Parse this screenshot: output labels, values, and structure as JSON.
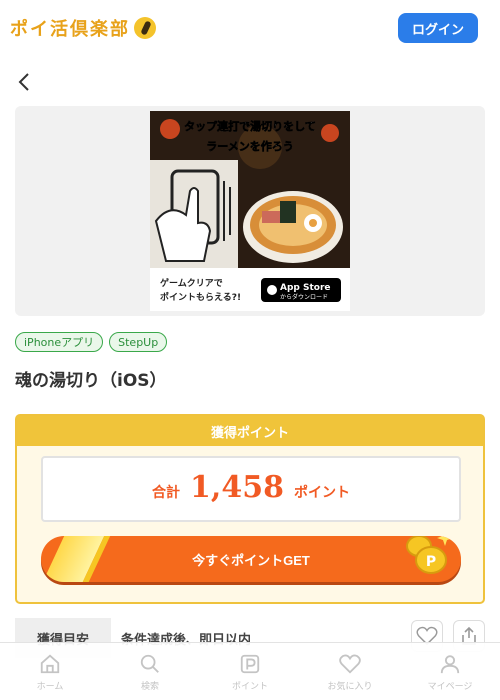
{
  "header": {
    "logo_text": "ポイ活倶楽部",
    "login_label": "ログイン"
  },
  "banner": {
    "headline_1": "タップ連打で湯切りをして",
    "headline_2": "ラーメンを作ろう",
    "footer_1": "ゲームクリアで",
    "footer_2": "ポイントもらえる?!",
    "store_badge_main": "App Store",
    "store_badge_sub": "からダウンロード"
  },
  "tags": [
    "iPhoneアプリ",
    "StepUp"
  ],
  "offer": {
    "title": "魂の湯切り（iOS）"
  },
  "points": {
    "header": "獲得ポイント",
    "total_label": "合計",
    "total_value": "1,458",
    "total_unit": "ポイント",
    "cta_label": "今すぐポイントGET"
  },
  "info": {
    "label": "獲得目安",
    "value": "条件達成後、即日以内"
  },
  "tabbar": {
    "home": "ホーム",
    "search": "検索",
    "points": "ポイント",
    "favorites": "お気に入り",
    "mypage": "マイページ"
  },
  "colors": {
    "accent_blue": "#2b7de9",
    "accent_orange": "#f56a1c",
    "accent_yellow": "#f0c43a",
    "tag_green": "#3aa84a"
  }
}
